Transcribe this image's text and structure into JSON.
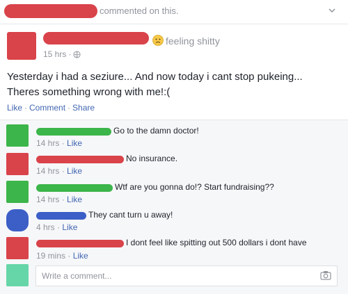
{
  "notification": {
    "text": "commented on this.",
    "chevron_icon": "chevron-down-icon"
  },
  "post": {
    "feeling": "feeling shitty",
    "feeling_icon": "sad-face-emoji-icon",
    "time": "15 hrs",
    "privacy_icon": "globe-icon",
    "body": "Yesterday i had a seziure... And now today i cant stop pukeing... Theres something wrong with me!:(",
    "actions": {
      "like": "Like",
      "comment": "Comment",
      "share": "Share"
    }
  },
  "comments": [
    {
      "text": "Go to the damn doctor!",
      "time": "14 hrs",
      "like": "Like",
      "color": "#3cb54a"
    },
    {
      "text": "No insurance.",
      "time": "14 hrs",
      "like": "Like",
      "color": "#d9434a"
    },
    {
      "text": "Wtf are you gonna do!? Start fundraising??",
      "time": "14 hrs",
      "like": "Like",
      "color": "#3cb54a"
    },
    {
      "text": "They cant turn u away!",
      "time": "4 hrs",
      "like": "Like",
      "color": "#3b5fc6"
    },
    {
      "text": "I dont feel like spitting out 500 dollars i dont have",
      "time": "19 mins",
      "like": "Like",
      "color": "#d9434a"
    }
  ],
  "composer": {
    "placeholder": "Write a comment...",
    "camera_icon": "camera-icon"
  },
  "colors": {
    "link": "#4267b2",
    "meta": "#90949c",
    "redaction_red": "#d9434a",
    "redaction_green": "#3cb54a",
    "redaction_blue": "#3b5fc6",
    "redaction_teal": "#66d6a8"
  }
}
